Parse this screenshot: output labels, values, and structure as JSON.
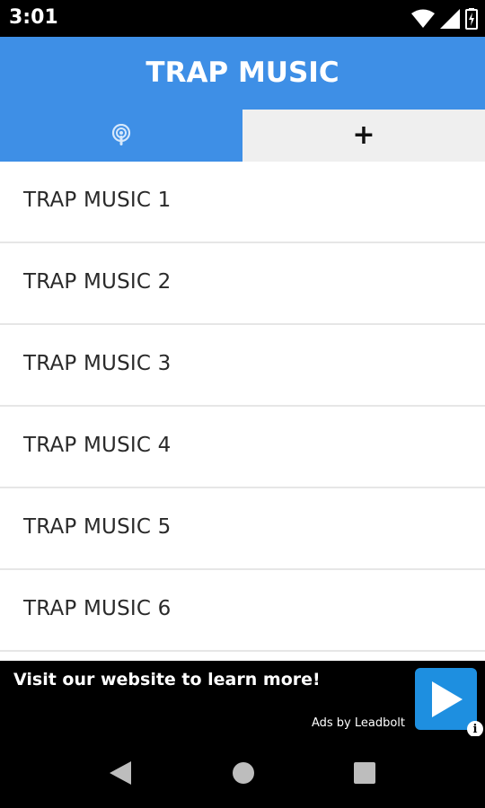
{
  "status_bar": {
    "time": "3:01",
    "icons": [
      "wifi-icon",
      "signal-icon",
      "battery-icon"
    ]
  },
  "app_bar": {
    "title": "TRAP MUSIC",
    "color": "#3e8fe6"
  },
  "tabs": [
    {
      "icon": "podcast-icon",
      "active": true
    },
    {
      "label": "+",
      "icon": "plus-icon",
      "active": false
    }
  ],
  "list": {
    "items": [
      {
        "label": "TRAP MUSIC 1"
      },
      {
        "label": "TRAP MUSIC 2"
      },
      {
        "label": "TRAP MUSIC 3"
      },
      {
        "label": "TRAP MUSIC 4"
      },
      {
        "label": "TRAP MUSIC 5"
      },
      {
        "label": "TRAP MUSIC 6"
      }
    ]
  },
  "ad": {
    "headline": "Visit our website to learn more!",
    "provider": "Ads by Leadbolt",
    "info_glyph": "i",
    "button_color": "#1e8fe0"
  },
  "nav_bar": {
    "buttons": [
      "back-icon",
      "home-icon",
      "recents-icon"
    ]
  }
}
